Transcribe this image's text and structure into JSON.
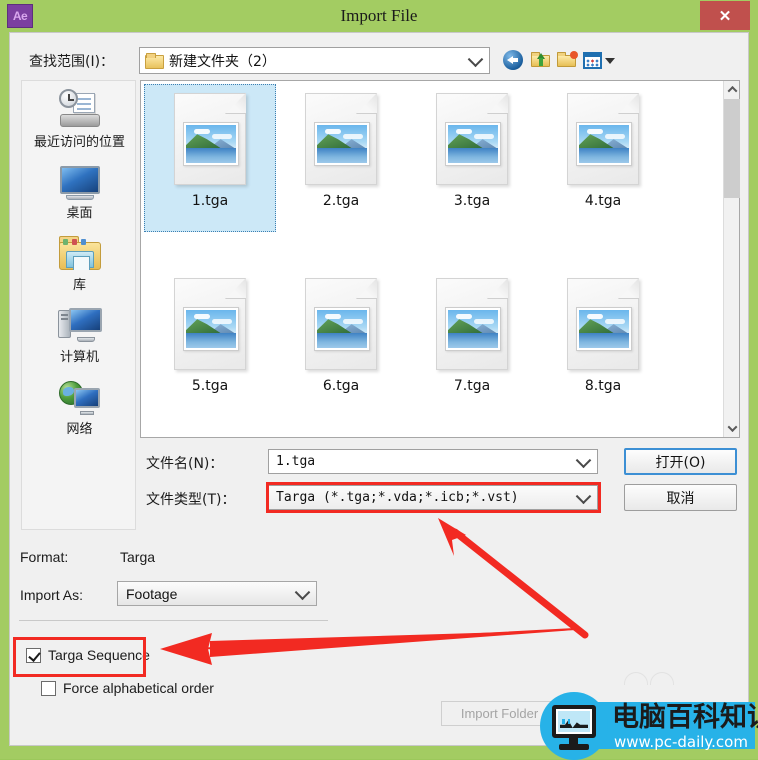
{
  "window": {
    "title": "Import File",
    "app_icon": "ae-logo",
    "close_label": "✕",
    "app_badge_text": "Ae",
    "frame_color": "#a3cc62",
    "close_color": "#c0504d"
  },
  "lookin": {
    "label": "查找范围(I)：",
    "value": "新建文件夹（2）",
    "toolbar": [
      {
        "name": "back-icon",
        "tooltip": "后退"
      },
      {
        "name": "up-one-level-icon",
        "tooltip": "向上一级"
      },
      {
        "name": "new-folder-icon",
        "tooltip": "新建文件夹"
      },
      {
        "name": "views-icon",
        "tooltip": "视图"
      }
    ]
  },
  "places": [
    {
      "label": "最近访问的位置",
      "icon": "recent-places-icon"
    },
    {
      "label": "桌面",
      "icon": "desktop-icon"
    },
    {
      "label": "库",
      "icon": "libraries-icon"
    },
    {
      "label": "计算机",
      "icon": "computer-icon"
    },
    {
      "label": "网络",
      "icon": "network-icon"
    }
  ],
  "files": [
    {
      "name": "1.tga",
      "selected": true
    },
    {
      "name": "2.tga",
      "selected": false
    },
    {
      "name": "3.tga",
      "selected": false
    },
    {
      "name": "4.tga",
      "selected": false
    },
    {
      "name": "5.tga",
      "selected": false
    },
    {
      "name": "6.tga",
      "selected": false
    },
    {
      "name": "7.tga",
      "selected": false
    },
    {
      "name": "8.tga",
      "selected": false
    }
  ],
  "filename_row": {
    "label": "文件名(N)：",
    "value": "1.tga"
  },
  "filetype_row": {
    "label": "文件类型(T)：",
    "value": "Targa (*.tga;*.vda;*.icb;*.vst)"
  },
  "buttons": {
    "open": "打开(O)",
    "cancel": "取消",
    "import_folder": "Import Folder"
  },
  "options": {
    "format_label": "Format:",
    "format_value": "Targa",
    "import_as_label": "Import As:",
    "import_as_value": "Footage",
    "targa_sequence_label": "Targa Sequence",
    "targa_sequence_checked": true,
    "force_alpha_label": "Force alphabetical order",
    "force_alpha_checked": false
  },
  "annotations": {
    "highlight_color": "#f22a22",
    "boxes": [
      "filetype-combo",
      "targa-sequence-checkbox"
    ],
    "arrows": [
      "arrow-to-filetype",
      "arrow-to-targa-sequence"
    ]
  },
  "watermark": {
    "title": "电脑百科知识",
    "url": "www.pc-daily.com",
    "color": "#27b2e8"
  }
}
